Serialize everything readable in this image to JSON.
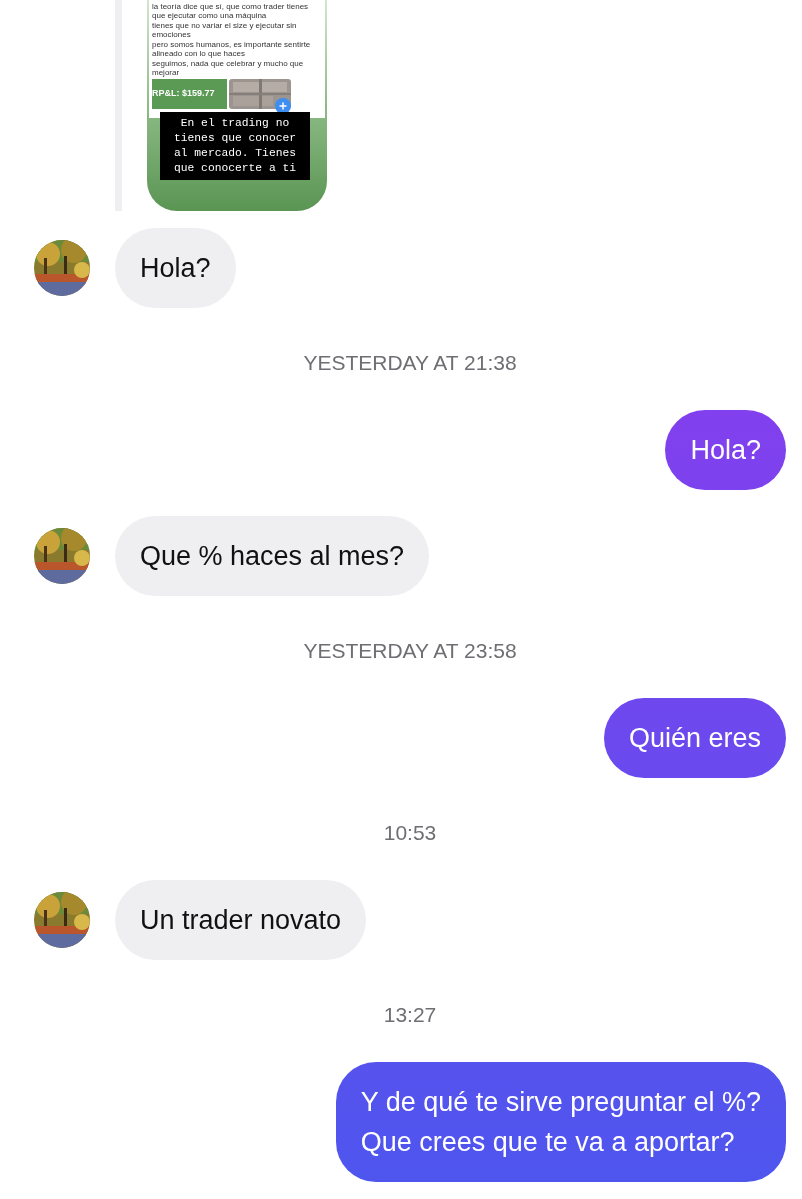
{
  "conversation": [
    {
      "kind": "story",
      "post_lines": [
        "la teoría dice que sí, que como trader tienes que ejecutar como una máquina",
        "tienes que no variar el size y ejecutar sin emociones",
        "pero somos humanos, es importante sentirte alineado con lo que haces",
        "seguimos, nada que celebrar y mucho que mejorar"
      ],
      "pnl": "RP&L: $159.77",
      "caption_lines": [
        "En el trading no",
        "tienes que conocer",
        "al mercado. Tienes",
        "que conocerte a ti"
      ]
    },
    {
      "kind": "message",
      "mine": false,
      "text": "Hola?"
    },
    {
      "kind": "timestamp",
      "text": "YESTERDAY AT 21:38"
    },
    {
      "kind": "message",
      "mine": true,
      "text": "Hola?"
    },
    {
      "kind": "message",
      "mine": false,
      "text": "Que % haces al mes?"
    },
    {
      "kind": "timestamp",
      "text": "YESTERDAY AT 23:58"
    },
    {
      "kind": "message",
      "mine": true,
      "text": "Quién eres"
    },
    {
      "kind": "timestamp",
      "text": "10:53"
    },
    {
      "kind": "message",
      "mine": false,
      "text": "Un trader novato"
    },
    {
      "kind": "timestamp",
      "text": "13:27"
    },
    {
      "kind": "message",
      "mine": true,
      "text": "Y de qué te sirve preguntar el %?\nQue crees que te va a aportar?"
    }
  ]
}
